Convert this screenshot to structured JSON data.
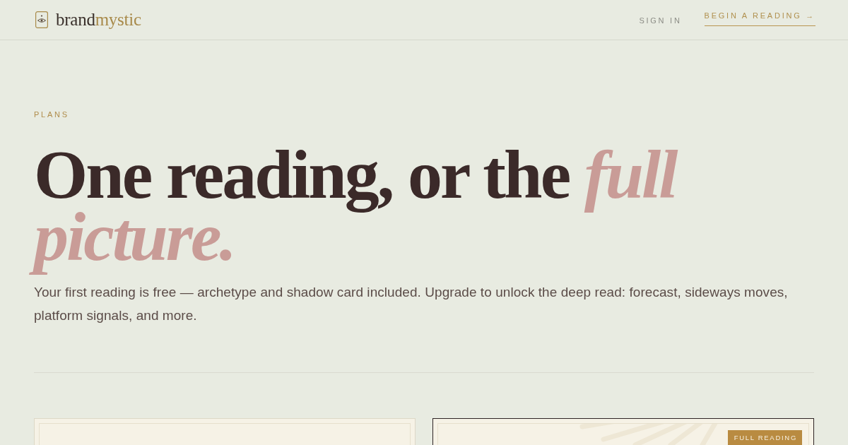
{
  "header": {
    "logo": {
      "brand": "brand",
      "accent": "mystic"
    },
    "nav": [
      {
        "kind": "link",
        "label": "SIGN IN"
      },
      {
        "kind": "cta",
        "label": "BEGIN A READING →"
      }
    ]
  },
  "hero": {
    "eyebrow": "PLANS",
    "title": "One reading, or the *full picture.*",
    "lede": "Your first reading is free — archetype and shadow card included. Upgrade to unlock the deep read: forecast, sideways moves, platform signals, and more."
  },
  "plans": [
    {
      "featured": false
    },
    {
      "featured": true,
      "badge": "FULL READING"
    }
  ]
}
